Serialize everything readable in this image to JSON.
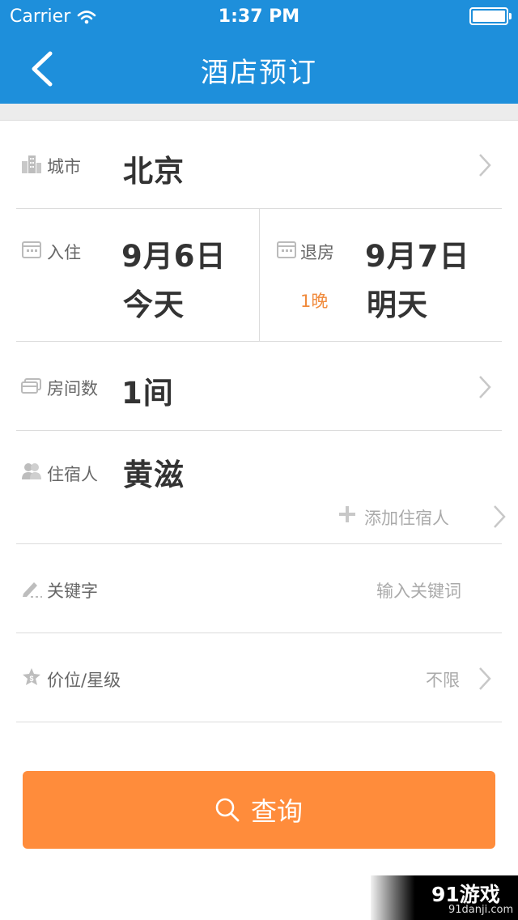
{
  "status_bar": {
    "carrier": "Carrier",
    "time": "1:37 PM"
  },
  "header": {
    "title": "酒店预订"
  },
  "city": {
    "label": "城市",
    "value": "北京"
  },
  "checkin": {
    "label": "入住",
    "date": "9月6日",
    "day": "今天"
  },
  "checkout": {
    "label": "退房",
    "date": "9月7日",
    "day": "明天",
    "nights": "1晚"
  },
  "rooms": {
    "label": "房间数",
    "value": "1间"
  },
  "guest": {
    "label": "住宿人",
    "name": "黄滋",
    "add": "添加住宿人"
  },
  "keyword": {
    "label": "关键字",
    "placeholder": "输入关键词"
  },
  "price": {
    "label": "价位/星级",
    "value": "不限"
  },
  "search_button": {
    "label": "查询"
  },
  "watermark": {
    "brand": "91游戏",
    "url": "91danji.com"
  },
  "colors": {
    "header": "#1e8fdb",
    "accent": "#ff8c3b",
    "nights": "#f08a3c"
  }
}
